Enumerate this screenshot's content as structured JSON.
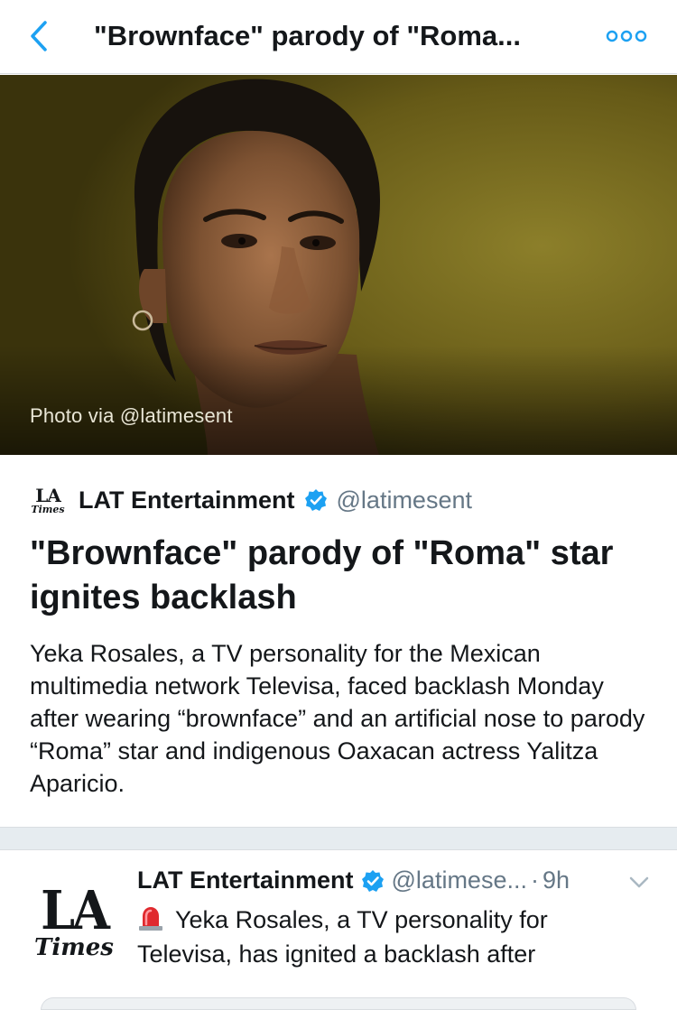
{
  "header": {
    "title": "\"Brownface\" parody of \"Roma...",
    "back_icon": "chevron-left-icon",
    "more_icon": "more-dots-icon",
    "accent_color": "#1da1f2"
  },
  "hero": {
    "photo_credit": "Photo via @latimesent",
    "background_color": "#6e6219"
  },
  "card": {
    "logo_top": "LA",
    "logo_bottom": "Times",
    "source_name": "LAT Entertainment",
    "source_handle": "@latimesent",
    "title": "\"Brownface\" parody of \"Roma\" star ignites backlash",
    "description": "Yeka Rosales, a TV personality for the Mexican multimedia network Televisa, faced backlash Monday after wearing “brownface” and an artificial nose to parody “Roma” star and indigenous Oaxacan actress Yalitza Aparicio."
  },
  "tweet": {
    "avatar_top": "LA",
    "avatar_bottom": "Times",
    "name": "LAT Entertainment",
    "handle": "@latimese...",
    "separator": "·",
    "time": "9h",
    "text": "Yeka Rosales, a TV personality for Televisa, has ignited a backlash after",
    "emoji_icon": "police-siren-icon"
  }
}
